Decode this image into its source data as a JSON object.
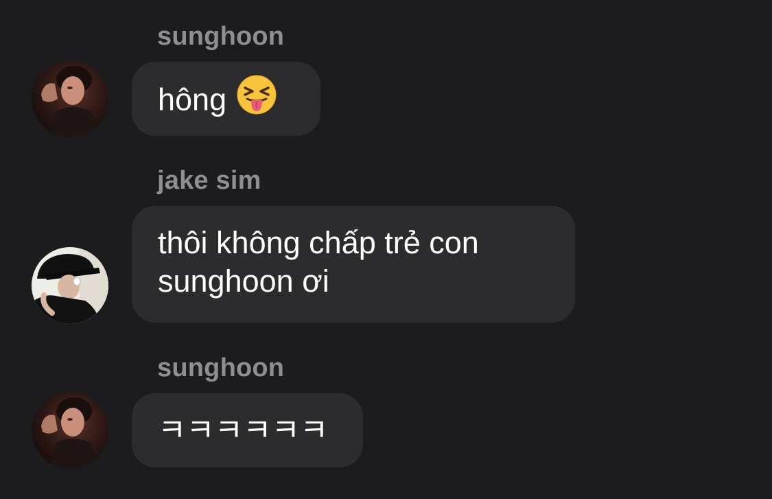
{
  "messages": [
    {
      "sender": "sunghoon",
      "avatar": "sunghoon-avatar",
      "text": "hông",
      "emoji": "squinting-face-with-tongue-icon"
    },
    {
      "sender": "jake sim",
      "avatar": "jake-sim-avatar",
      "text": "thôi không chấp trẻ con\nsunghoon ơi"
    },
    {
      "sender": "sunghoon",
      "avatar": "sunghoon-avatar",
      "text": "ㅋㅋㅋㅋㅋㅋ"
    }
  ],
  "colors": {
    "background": "#1c1c1e",
    "bubble": "#2c2c2e",
    "sender_name": "#8e8e93",
    "message_text": "#ffffff"
  }
}
